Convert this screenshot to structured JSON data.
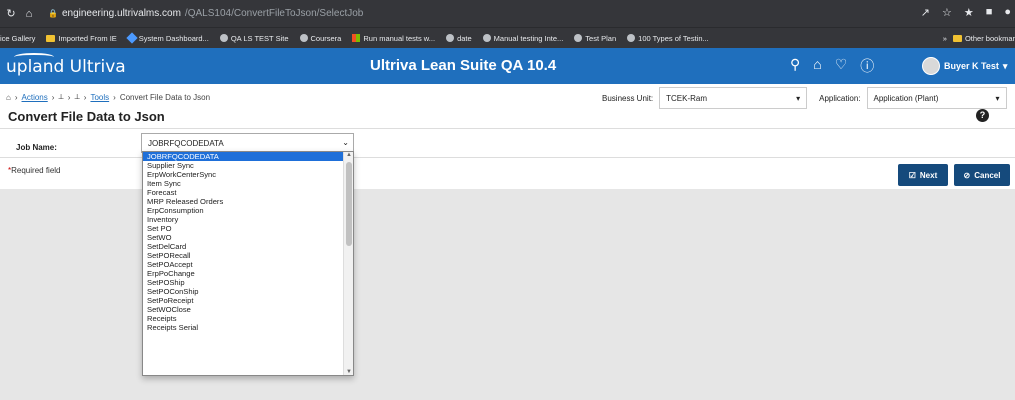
{
  "browser": {
    "url_host": "engineering.ultrivalms.com",
    "url_path": "/QALS104/ConvertFileToJson/SelectJob",
    "bookmarks": [
      {
        "label": "ice Gallery",
        "icon": "none"
      },
      {
        "label": "Imported From IE",
        "icon": "folder"
      },
      {
        "label": "System Dashboard...",
        "icon": "jira"
      },
      {
        "label": "QA LS TEST Site",
        "icon": "globe"
      },
      {
        "label": "Coursera",
        "icon": "globe"
      },
      {
        "label": "Run manual tests w...",
        "icon": "msft"
      },
      {
        "label": "date",
        "icon": "globe"
      },
      {
        "label": "Manual testing Inte...",
        "icon": "globe"
      },
      {
        "label": "Test Plan",
        "icon": "globe"
      },
      {
        "label": "100 Types of Testin...",
        "icon": "globe"
      }
    ],
    "more_bookmarks": "»",
    "other_bookmarks": "Other bookmar"
  },
  "app": {
    "logo": "upland Ultriva",
    "suite_title": "Ultriva Lean Suite QA 10.4",
    "user_name": "Buyer K Test"
  },
  "breadcrumb": {
    "actions": "Actions",
    "tools": "Tools",
    "current": "Convert File Data to Json"
  },
  "filters": {
    "business_unit_label": "Business Unit:",
    "business_unit_value": "TCEK-Ram",
    "application_label": "Application:",
    "application_value": "Application (Plant)"
  },
  "page": {
    "title": "Convert File Data to Json",
    "job_name_label": "Job Name:",
    "job_name_value": "JOBRFQCODEDATA",
    "required_note": "Required field",
    "next_button": "Next",
    "cancel_button": "Cancel"
  },
  "dropdown_options": [
    "JOBRFQCODEDATA",
    "Supplier Sync",
    "ErpWorkCenterSync",
    "Item Sync",
    "Forecast",
    "MRP Released Orders",
    "ErpConsumption",
    "Inventory",
    "Set PO",
    "SetWO",
    "SetDelCard",
    "SetPORecall",
    "SetPOAccept",
    "ErpPoChange",
    "SetPOShip",
    "SetPOConShip",
    "SetPoReceipt",
    "SetWOClose",
    "Receipts",
    "Receipts Serial"
  ],
  "colors": {
    "app_bar": "#1f6fbd",
    "button": "#154a7c",
    "selected_option": "#1e6fd9"
  }
}
